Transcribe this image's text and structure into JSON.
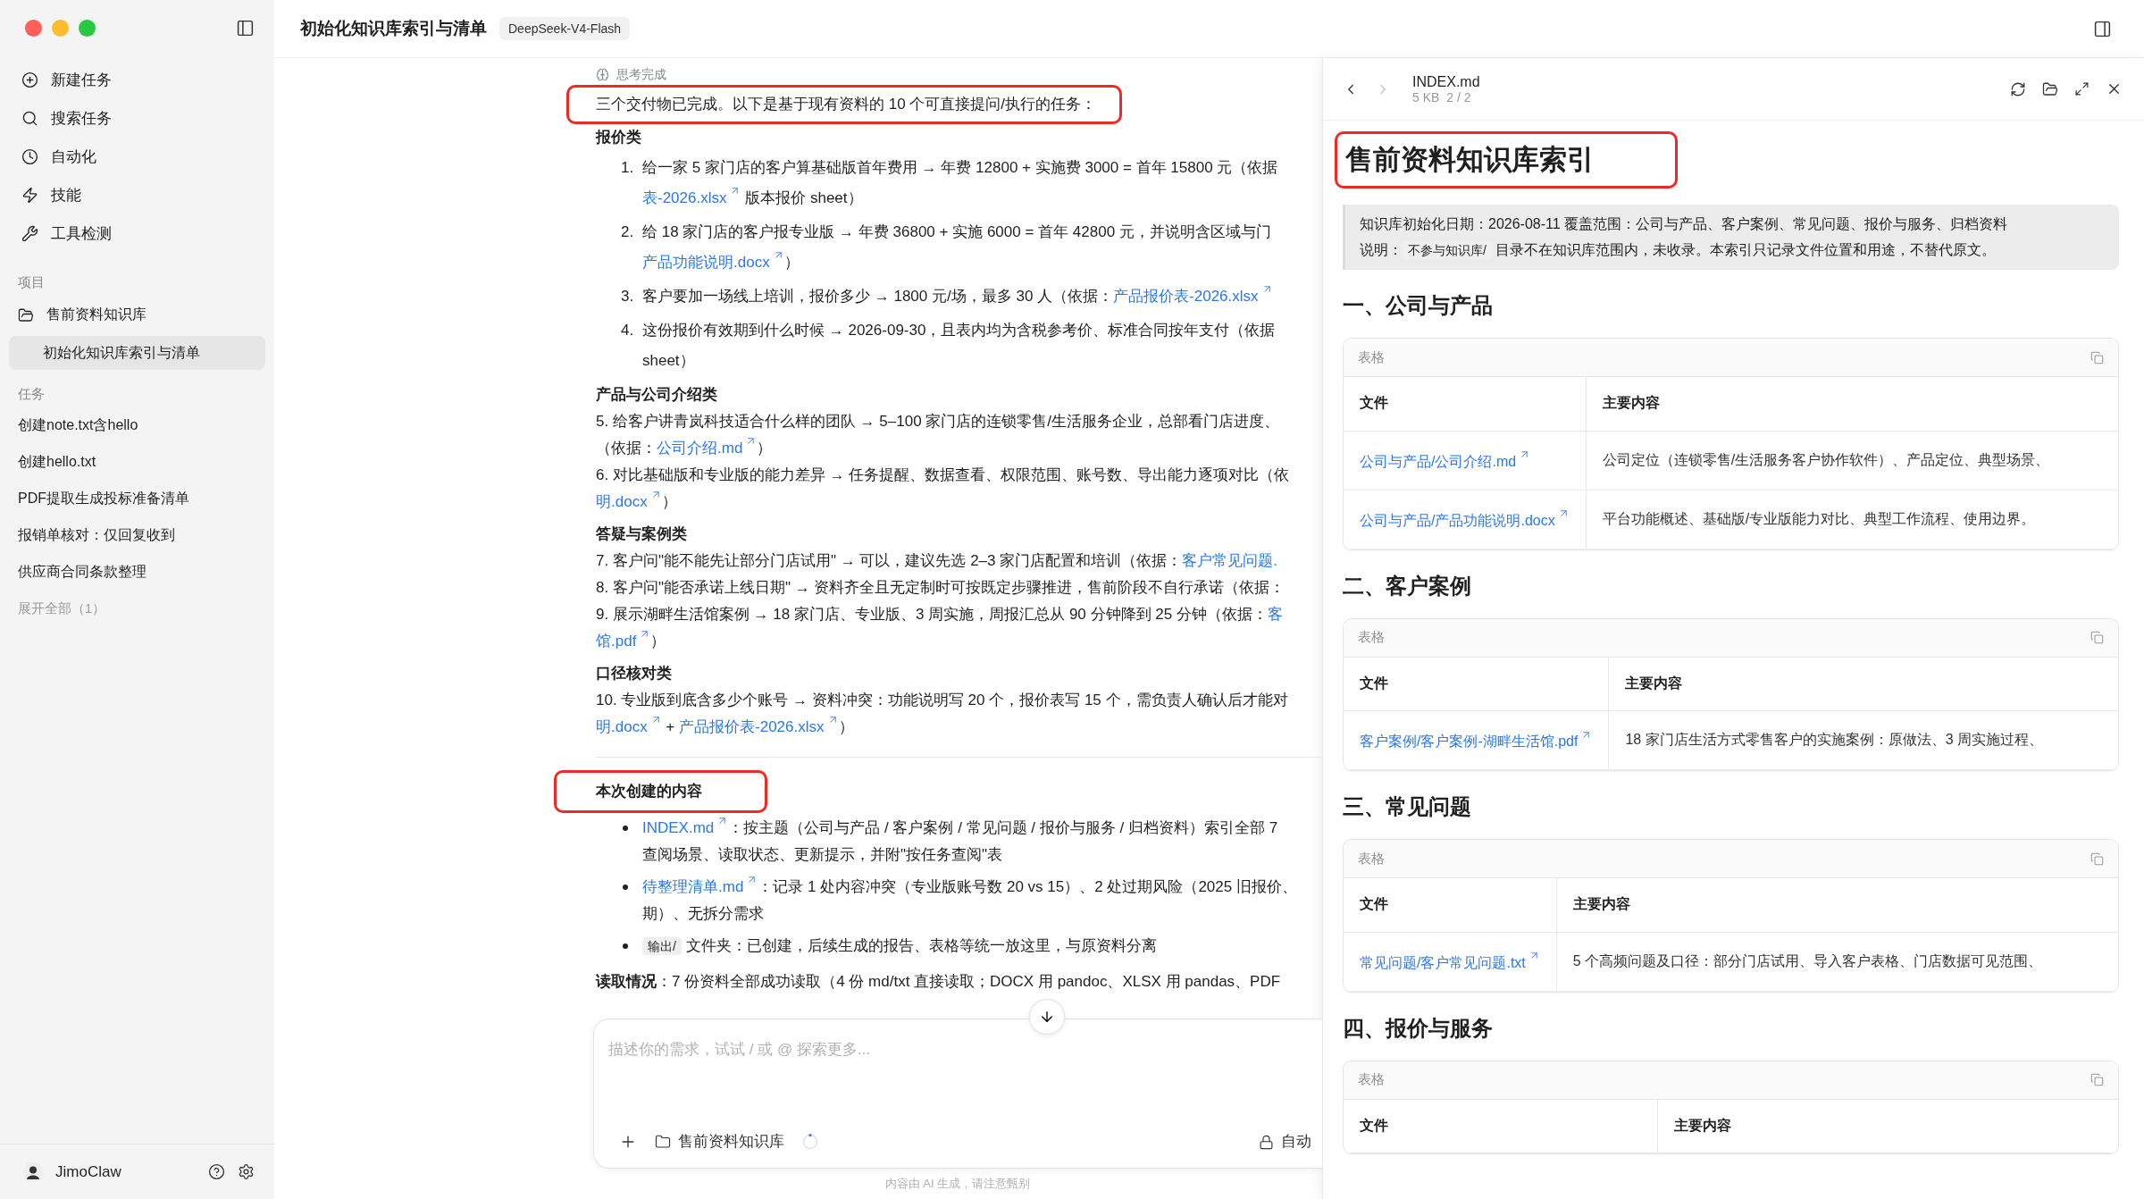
{
  "sidebar": {
    "nav": [
      {
        "kind": "new",
        "label": "新建任务"
      },
      {
        "kind": "search",
        "label": "搜索任务"
      },
      {
        "kind": "automation",
        "label": "自动化"
      },
      {
        "kind": "skills",
        "label": "技能"
      },
      {
        "kind": "tools",
        "label": "工具检测"
      }
    ],
    "projects_heading": "项目",
    "project": {
      "name": "售前资料知识库",
      "children": [
        {
          "label": "初始化知识库索引与清单",
          "selected": true
        }
      ]
    },
    "tasks_heading": "任务",
    "tasks": [
      {
        "label": "创建note.txt含hello",
        "selected": false
      },
      {
        "label": "创建hello.txt",
        "selected": false
      },
      {
        "label": "PDF提取生成投标准备清单",
        "selected": false
      },
      {
        "label": "报销单核对：仅回复收到",
        "selected": false
      },
      {
        "label": "供应商合同条款整理",
        "selected": false
      }
    ],
    "expand_all": "展开全部（1）",
    "user": {
      "name": "JimoClaw"
    }
  },
  "header": {
    "title": "初始化知识库索引与清单",
    "model": "DeepSeek-V4-Flash"
  },
  "chat": {
    "status": "思考完成",
    "intro": {
      "text": "三个交付物已完成。以下是基于现有资料的 10 个可直接提问/执行的任务：",
      "highlighted": true
    },
    "groups": [
      {
        "title": "报价类",
        "kind": "ordered",
        "items": [
          {
            "number": "1.",
            "lines": [
              [
                {
                  "kind": "text",
                  "text": "给一家 5 家门店的客户算基础版首年费用 → 年费 12800 + 实施费 3000 = 首年 15800 元（依据"
                }
              ],
              [
                {
                  "kind": "link",
                  "text": "表-2026.xlsx",
                  "arrow": true
                },
                {
                  "kind": "text",
                  "text": " 版本报价 sheet）"
                }
              ]
            ]
          },
          {
            "number": "2.",
            "lines": [
              [
                {
                  "kind": "text",
                  "text": "给 18 家门店的客户报专业版 → 年费 36800 + 实施 6000 = 首年 42800 元，并说明含区域与门"
                }
              ],
              [
                {
                  "kind": "link",
                  "text": "产品功能说明.docx",
                  "arrow": true
                },
                {
                  "kind": "text",
                  "text": "）"
                }
              ]
            ]
          },
          {
            "number": "3.",
            "lines": [
              [
                {
                  "kind": "text",
                  "text": "客户要加一场线上培训，报价多少 → 1800 元/场，最多 30 人（依据："
                },
                {
                  "kind": "link",
                  "text": "产品报价表-2026.xlsx",
                  "arrow": true
                }
              ]
            ]
          },
          {
            "number": "4.",
            "lines": [
              [
                {
                  "kind": "text",
                  "text": "这份报价有效期到什么时候 → 2026-09-30，且表内均为含税参考价、标准合同按年支付（依据"
                }
              ],
              [
                {
                  "kind": "text",
                  "text": "sheet）"
                }
              ]
            ]
          }
        ]
      },
      {
        "title": "产品与公司介绍类",
        "kind": "plain",
        "items": [
          {
            "lines": [
              [
                {
                  "kind": "text",
                  "text": "5. 给客户讲青岚科技适合什么样的团队 → 5–100 家门店的连锁零售/生活服务企业，总部看门店进度、"
                }
              ],
              [
                {
                  "kind": "text",
                  "text": "（依据："
                },
                {
                  "kind": "link",
                  "text": "公司介绍.md",
                  "arrow": true
                },
                {
                  "kind": "text",
                  "text": "）"
                }
              ]
            ]
          },
          {
            "lines": [
              [
                {
                  "kind": "text",
                  "text": "6. 对比基础版和专业版的能力差异 → 任务提醒、数据查看、权限范围、账号数、导出能力逐项对比（依"
                }
              ],
              [
                {
                  "kind": "link",
                  "text": "明.docx",
                  "arrow": true
                },
                {
                  "kind": "text",
                  "text": "）"
                }
              ]
            ]
          }
        ]
      },
      {
        "title": "答疑与案例类",
        "kind": "plain",
        "items": [
          {
            "lines": [
              [
                {
                  "kind": "text",
                  "text": "7. 客户问\"能不能先让部分门店试用\" → 可以，建议先选 2–3 家门店配置和培训（依据："
                },
                {
                  "kind": "link",
                  "text": "客户常见问题.",
                  "arrow": false
                }
              ]
            ]
          },
          {
            "lines": [
              [
                {
                  "kind": "text",
                  "text": "8. 客户问\"能否承诺上线日期\" → 资料齐全且无定制时可按既定步骤推进，售前阶段不自行承诺（依据："
                }
              ]
            ]
          },
          {
            "lines": [
              [
                {
                  "kind": "text",
                  "text": "9. 展示湖畔生活馆案例 → 18 家门店、专业版、3 周实施，周报汇总从 90 分钟降到 25 分钟（依据："
                },
                {
                  "kind": "link",
                  "text": "客",
                  "arrow": false
                }
              ],
              [
                {
                  "kind": "link",
                  "text": "馆.pdf",
                  "arrow": true
                },
                {
                  "kind": "text",
                  "text": "）"
                }
              ]
            ]
          }
        ]
      },
      {
        "title": "口径核对类",
        "kind": "plain",
        "items": [
          {
            "lines": [
              [
                {
                  "kind": "text",
                  "text": "10. 专业版到底含多少个账号 → 资料冲突：功能说明写 20 个，报价表写 15 个，需负责人确认后才能对"
                }
              ],
              [
                {
                  "kind": "link",
                  "text": "明.docx",
                  "arrow": true
                },
                {
                  "kind": "text",
                  "text": " + "
                },
                {
                  "kind": "link",
                  "text": "产品报价表-2026.xlsx",
                  "arrow": true
                },
                {
                  "kind": "text",
                  "text": "）"
                }
              ]
            ]
          }
        ]
      }
    ],
    "created": {
      "heading": {
        "text": "本次创建的内容",
        "highlighted": true
      },
      "bullets": [
        {
          "lines": [
            [
              {
                "kind": "link",
                "text": "INDEX.md",
                "arrow": true
              },
              {
                "kind": "text",
                "text": "：按主题（公司与产品 / 客户案例 / 常见问题 / 报价与服务 / 归档资料）索引全部 7"
              }
            ],
            [
              {
                "kind": "text",
                "text": "查阅场景、读取状态、更新提示，并附\"按任务查阅\"表"
              }
            ]
          ]
        },
        {
          "lines": [
            [
              {
                "kind": "link",
                "text": "待整理清单.md",
                "arrow": true
              },
              {
                "kind": "text",
                "text": "：记录 1 处内容冲突（专业版账号数 20 vs 15）、2 处过期风险（2025 旧报价、"
              }
            ],
            [
              {
                "kind": "text",
                "text": "期）、无拆分需求"
              }
            ]
          ]
        },
        {
          "lines": [
            [
              {
                "kind": "code",
                "text": "输出/"
              },
              {
                "kind": "text",
                "text": " 文件夹：已创建，后续生成的报告、表格等统一放这里，与原资料分离"
              }
            ]
          ]
        }
      ]
    },
    "reading": [
      {
        "kind": "bold",
        "text": "读取情况"
      },
      {
        "kind": "text",
        "text": "：7 份资料全部成功读取（4 份 md/txt 直接读取；DOCX 用 pandoc、XLSX 用 pandas、PDF"
      }
    ],
    "input": {
      "placeholder": "描述你的需求，试试 / 或 @ 探索更多...",
      "project": "售前资料知识库",
      "mode": "自动"
    },
    "note": "内容由 AI 生成，请注意甄别"
  },
  "preview": {
    "nav": [
      {
        "kind": "back",
        "disabled": false
      },
      {
        "kind": "forward",
        "disabled": true
      }
    ],
    "filename": "INDEX.md",
    "size": "5 KB",
    "page": "2 / 2",
    "title": {
      "text": "售前资料知识库索引",
      "highlighted": true
    },
    "info": [
      [
        {
          "kind": "text",
          "text": "知识库初始化日期：2026-08-11 覆盖范围：公司与产品、客户案例、常见问题、报价与服务、归档资料"
        }
      ],
      [
        {
          "kind": "text",
          "text": "说明："
        },
        {
          "kind": "code",
          "text": "不参与知识库/"
        },
        {
          "kind": "text",
          "text": " 目录不在知识库范围内，未收录。本索引只记录文件位置和用途，不替代原文。"
        }
      ]
    ],
    "sections": [
      {
        "heading": "一、公司与产品",
        "table": {
          "label": "表格",
          "columns": [
            "文件",
            "主要内容"
          ],
          "rows": [
            [
              "公司与产品/公司介绍.md",
              "公司定位（连锁零售/生活服务客户协作软件）、产品定位、典型场景、"
            ],
            [
              "公司与产品/产品功能说明.docx",
              "平台功能概述、基础版/专业版能力对比、典型工作流程、使用边界。"
            ]
          ]
        }
      },
      {
        "heading": "二、客户案例",
        "table": {
          "label": "表格",
          "columns": [
            "文件",
            "主要内容"
          ],
          "rows": [
            [
              "客户案例/客户案例-湖畔生活馆.pdf",
              "18 家门店生活方式零售客户的实施案例：原做法、3 周实施过程、"
            ]
          ]
        }
      },
      {
        "heading": "三、常见问题",
        "table": {
          "label": "表格",
          "columns": [
            "文件",
            "主要内容"
          ],
          "rows": [
            [
              "常见问题/客户常见问题.txt",
              "5 个高频问题及口径：部分门店试用、导入客户表格、门店数据可见范围、"
            ]
          ]
        }
      },
      {
        "heading": "四、报价与服务",
        "table": {
          "label": "表格",
          "columns": [
            "文件",
            "主要内容"
          ]
        }
      }
    ]
  }
}
